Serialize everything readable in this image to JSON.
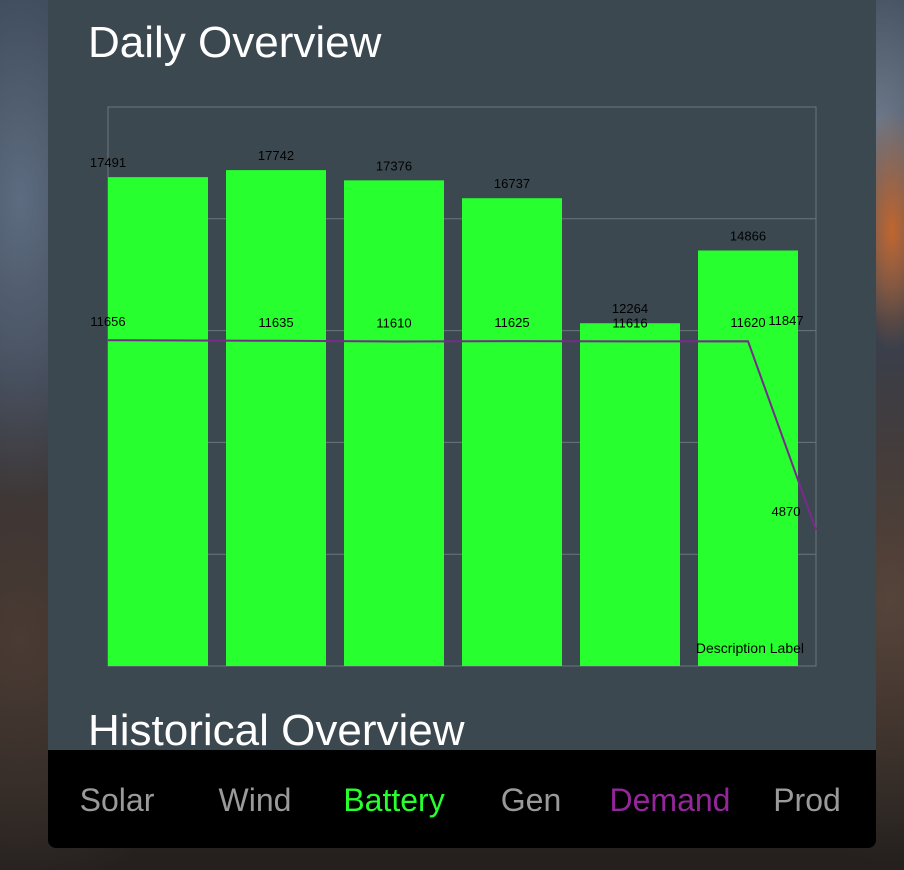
{
  "titles": {
    "daily": "Daily Overview",
    "historical": "Historical Overview"
  },
  "tabs": [
    {
      "label": "Solar",
      "color": "#9a9a9a"
    },
    {
      "label": "Wind",
      "color": "#9a9a9a"
    },
    {
      "label": "Battery",
      "color": "#27ff2f"
    },
    {
      "label": "Gen",
      "color": "#9a9a9a"
    },
    {
      "label": "Demand",
      "color": "#93279a"
    },
    {
      "label": "Prod",
      "color": "#9a9a9a"
    }
  ],
  "colors": {
    "panel": "#3b4850",
    "bar": "#27ff2f",
    "line": "#7a2a8c",
    "grid": "#6b757c",
    "tabbar": "#000000"
  },
  "chart_data": {
    "type": "bar",
    "description": "Description Label",
    "ylim": [
      0,
      20000
    ],
    "grid": true,
    "series": [
      {
        "type": "bar",
        "values": [
          17491,
          17742,
          17376,
          16737,
          12264,
          14866,
          11847
        ]
      },
      {
        "type": "line",
        "values": [
          11656,
          11635,
          11610,
          11625,
          11616,
          11620,
          4870
        ]
      }
    ]
  }
}
